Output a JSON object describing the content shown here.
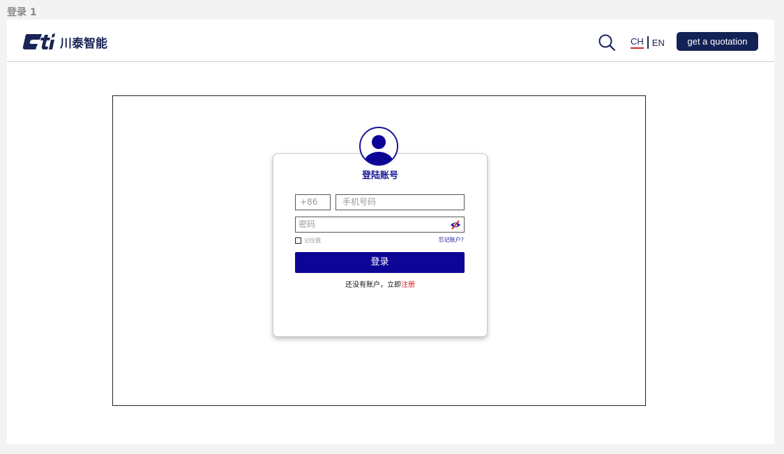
{
  "page_label": "登录 1",
  "header": {
    "logo_mark": "Cti",
    "logo_text": "川泰智能",
    "lang_ch": "CH",
    "lang_en": "EN",
    "quote_button": "get a quotation"
  },
  "login": {
    "title": "登陆账号",
    "country_code_placeholder": "+86",
    "phone_placeholder": "手机号码",
    "password_placeholder": "密码",
    "remember_label": "记住我",
    "forgot_link": "忘记账户?",
    "submit_label": "登录",
    "register_prompt": "还没有账户，立即",
    "register_link": "注册"
  },
  "colors": {
    "brand_navy": "#132255",
    "primary_blue": "#0d0596",
    "accent_red": "#d42020"
  }
}
